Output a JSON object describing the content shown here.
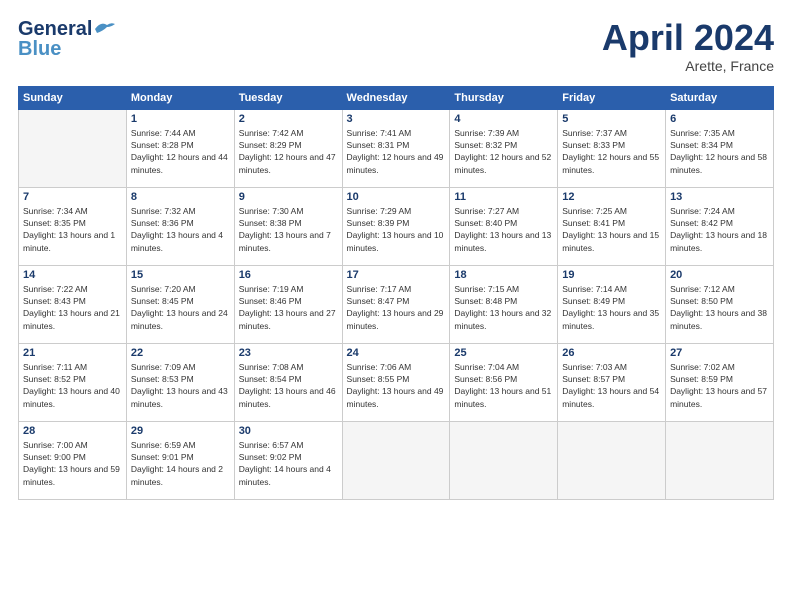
{
  "header": {
    "logo_general": "General",
    "logo_blue": "Blue",
    "month_year": "April 2024",
    "location": "Arette, France"
  },
  "days_of_week": [
    "Sunday",
    "Monday",
    "Tuesday",
    "Wednesday",
    "Thursday",
    "Friday",
    "Saturday"
  ],
  "weeks": [
    [
      {
        "day": "",
        "empty": true
      },
      {
        "day": "1",
        "sunrise": "Sunrise: 7:44 AM",
        "sunset": "Sunset: 8:28 PM",
        "daylight": "Daylight: 12 hours and 44 minutes."
      },
      {
        "day": "2",
        "sunrise": "Sunrise: 7:42 AM",
        "sunset": "Sunset: 8:29 PM",
        "daylight": "Daylight: 12 hours and 47 minutes."
      },
      {
        "day": "3",
        "sunrise": "Sunrise: 7:41 AM",
        "sunset": "Sunset: 8:31 PM",
        "daylight": "Daylight: 12 hours and 49 minutes."
      },
      {
        "day": "4",
        "sunrise": "Sunrise: 7:39 AM",
        "sunset": "Sunset: 8:32 PM",
        "daylight": "Daylight: 12 hours and 52 minutes."
      },
      {
        "day": "5",
        "sunrise": "Sunrise: 7:37 AM",
        "sunset": "Sunset: 8:33 PM",
        "daylight": "Daylight: 12 hours and 55 minutes."
      },
      {
        "day": "6",
        "sunrise": "Sunrise: 7:35 AM",
        "sunset": "Sunset: 8:34 PM",
        "daylight": "Daylight: 12 hours and 58 minutes."
      }
    ],
    [
      {
        "day": "7",
        "sunrise": "Sunrise: 7:34 AM",
        "sunset": "Sunset: 8:35 PM",
        "daylight": "Daylight: 13 hours and 1 minute."
      },
      {
        "day": "8",
        "sunrise": "Sunrise: 7:32 AM",
        "sunset": "Sunset: 8:36 PM",
        "daylight": "Daylight: 13 hours and 4 minutes."
      },
      {
        "day": "9",
        "sunrise": "Sunrise: 7:30 AM",
        "sunset": "Sunset: 8:38 PM",
        "daylight": "Daylight: 13 hours and 7 minutes."
      },
      {
        "day": "10",
        "sunrise": "Sunrise: 7:29 AM",
        "sunset": "Sunset: 8:39 PM",
        "daylight": "Daylight: 13 hours and 10 minutes."
      },
      {
        "day": "11",
        "sunrise": "Sunrise: 7:27 AM",
        "sunset": "Sunset: 8:40 PM",
        "daylight": "Daylight: 13 hours and 13 minutes."
      },
      {
        "day": "12",
        "sunrise": "Sunrise: 7:25 AM",
        "sunset": "Sunset: 8:41 PM",
        "daylight": "Daylight: 13 hours and 15 minutes."
      },
      {
        "day": "13",
        "sunrise": "Sunrise: 7:24 AM",
        "sunset": "Sunset: 8:42 PM",
        "daylight": "Daylight: 13 hours and 18 minutes."
      }
    ],
    [
      {
        "day": "14",
        "sunrise": "Sunrise: 7:22 AM",
        "sunset": "Sunset: 8:43 PM",
        "daylight": "Daylight: 13 hours and 21 minutes."
      },
      {
        "day": "15",
        "sunrise": "Sunrise: 7:20 AM",
        "sunset": "Sunset: 8:45 PM",
        "daylight": "Daylight: 13 hours and 24 minutes."
      },
      {
        "day": "16",
        "sunrise": "Sunrise: 7:19 AM",
        "sunset": "Sunset: 8:46 PM",
        "daylight": "Daylight: 13 hours and 27 minutes."
      },
      {
        "day": "17",
        "sunrise": "Sunrise: 7:17 AM",
        "sunset": "Sunset: 8:47 PM",
        "daylight": "Daylight: 13 hours and 29 minutes."
      },
      {
        "day": "18",
        "sunrise": "Sunrise: 7:15 AM",
        "sunset": "Sunset: 8:48 PM",
        "daylight": "Daylight: 13 hours and 32 minutes."
      },
      {
        "day": "19",
        "sunrise": "Sunrise: 7:14 AM",
        "sunset": "Sunset: 8:49 PM",
        "daylight": "Daylight: 13 hours and 35 minutes."
      },
      {
        "day": "20",
        "sunrise": "Sunrise: 7:12 AM",
        "sunset": "Sunset: 8:50 PM",
        "daylight": "Daylight: 13 hours and 38 minutes."
      }
    ],
    [
      {
        "day": "21",
        "sunrise": "Sunrise: 7:11 AM",
        "sunset": "Sunset: 8:52 PM",
        "daylight": "Daylight: 13 hours and 40 minutes."
      },
      {
        "day": "22",
        "sunrise": "Sunrise: 7:09 AM",
        "sunset": "Sunset: 8:53 PM",
        "daylight": "Daylight: 13 hours and 43 minutes."
      },
      {
        "day": "23",
        "sunrise": "Sunrise: 7:08 AM",
        "sunset": "Sunset: 8:54 PM",
        "daylight": "Daylight: 13 hours and 46 minutes."
      },
      {
        "day": "24",
        "sunrise": "Sunrise: 7:06 AM",
        "sunset": "Sunset: 8:55 PM",
        "daylight": "Daylight: 13 hours and 49 minutes."
      },
      {
        "day": "25",
        "sunrise": "Sunrise: 7:04 AM",
        "sunset": "Sunset: 8:56 PM",
        "daylight": "Daylight: 13 hours and 51 minutes."
      },
      {
        "day": "26",
        "sunrise": "Sunrise: 7:03 AM",
        "sunset": "Sunset: 8:57 PM",
        "daylight": "Daylight: 13 hours and 54 minutes."
      },
      {
        "day": "27",
        "sunrise": "Sunrise: 7:02 AM",
        "sunset": "Sunset: 8:59 PM",
        "daylight": "Daylight: 13 hours and 57 minutes."
      }
    ],
    [
      {
        "day": "28",
        "sunrise": "Sunrise: 7:00 AM",
        "sunset": "Sunset: 9:00 PM",
        "daylight": "Daylight: 13 hours and 59 minutes."
      },
      {
        "day": "29",
        "sunrise": "Sunrise: 6:59 AM",
        "sunset": "Sunset: 9:01 PM",
        "daylight": "Daylight: 14 hours and 2 minutes."
      },
      {
        "day": "30",
        "sunrise": "Sunrise: 6:57 AM",
        "sunset": "Sunset: 9:02 PM",
        "daylight": "Daylight: 14 hours and 4 minutes."
      },
      {
        "day": "",
        "empty": true
      },
      {
        "day": "",
        "empty": true
      },
      {
        "day": "",
        "empty": true
      },
      {
        "day": "",
        "empty": true
      }
    ]
  ]
}
